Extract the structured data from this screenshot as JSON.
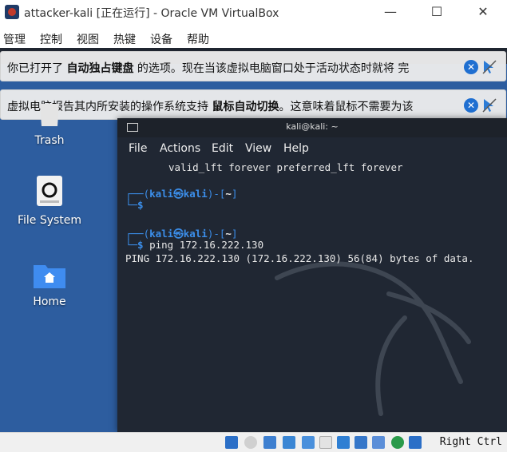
{
  "window": {
    "title": "attacker-kali [正在运行] - Oracle VM VirtualBox",
    "minimize": "—",
    "maximize": "☐",
    "close": "✕"
  },
  "menu": [
    "管理",
    "控制",
    "视图",
    "热键",
    "设备",
    "帮助"
  ],
  "notices": [
    {
      "pre": "你已打开了 ",
      "bold": "自动独占键盘",
      "post": " 的选项。现在当该虚拟电脑窗口处于活动状态时就将  完"
    },
    {
      "pre": "虚拟电脑报告其内所安装的操作系统支持 ",
      "bold": "鼠标自动切换",
      "post": "。这意味着鼠标不需要为该"
    }
  ],
  "desktop": {
    "trash": "Trash",
    "filesystem": "File System",
    "home": "Home"
  },
  "terminal": {
    "title": "kali@kali: ~",
    "menu": [
      "File",
      "Actions",
      "Edit",
      "View",
      "Help"
    ],
    "lines": {
      "l1": "valid_lft forever preferred_lft forever",
      "p1_open": "┌──(",
      "p1_user": "kali㉿kali",
      "p1_close": ")-[",
      "p1_dir": "~",
      "p1_end": "]",
      "p1_prompt": "└─$",
      "p2_open": "┌──(",
      "p2_user": "kali㉿kali",
      "p2_close": ")-[",
      "p2_dir": "~",
      "p2_end": "]",
      "p2_prompt": "└─$",
      "p2_cmd": "ping 172.16.222.130",
      "out1": "PING 172.16.222.130 (172.16.222.130) 56(84) bytes of data."
    }
  },
  "statusbar": {
    "hostkey": "Right Ctrl"
  }
}
